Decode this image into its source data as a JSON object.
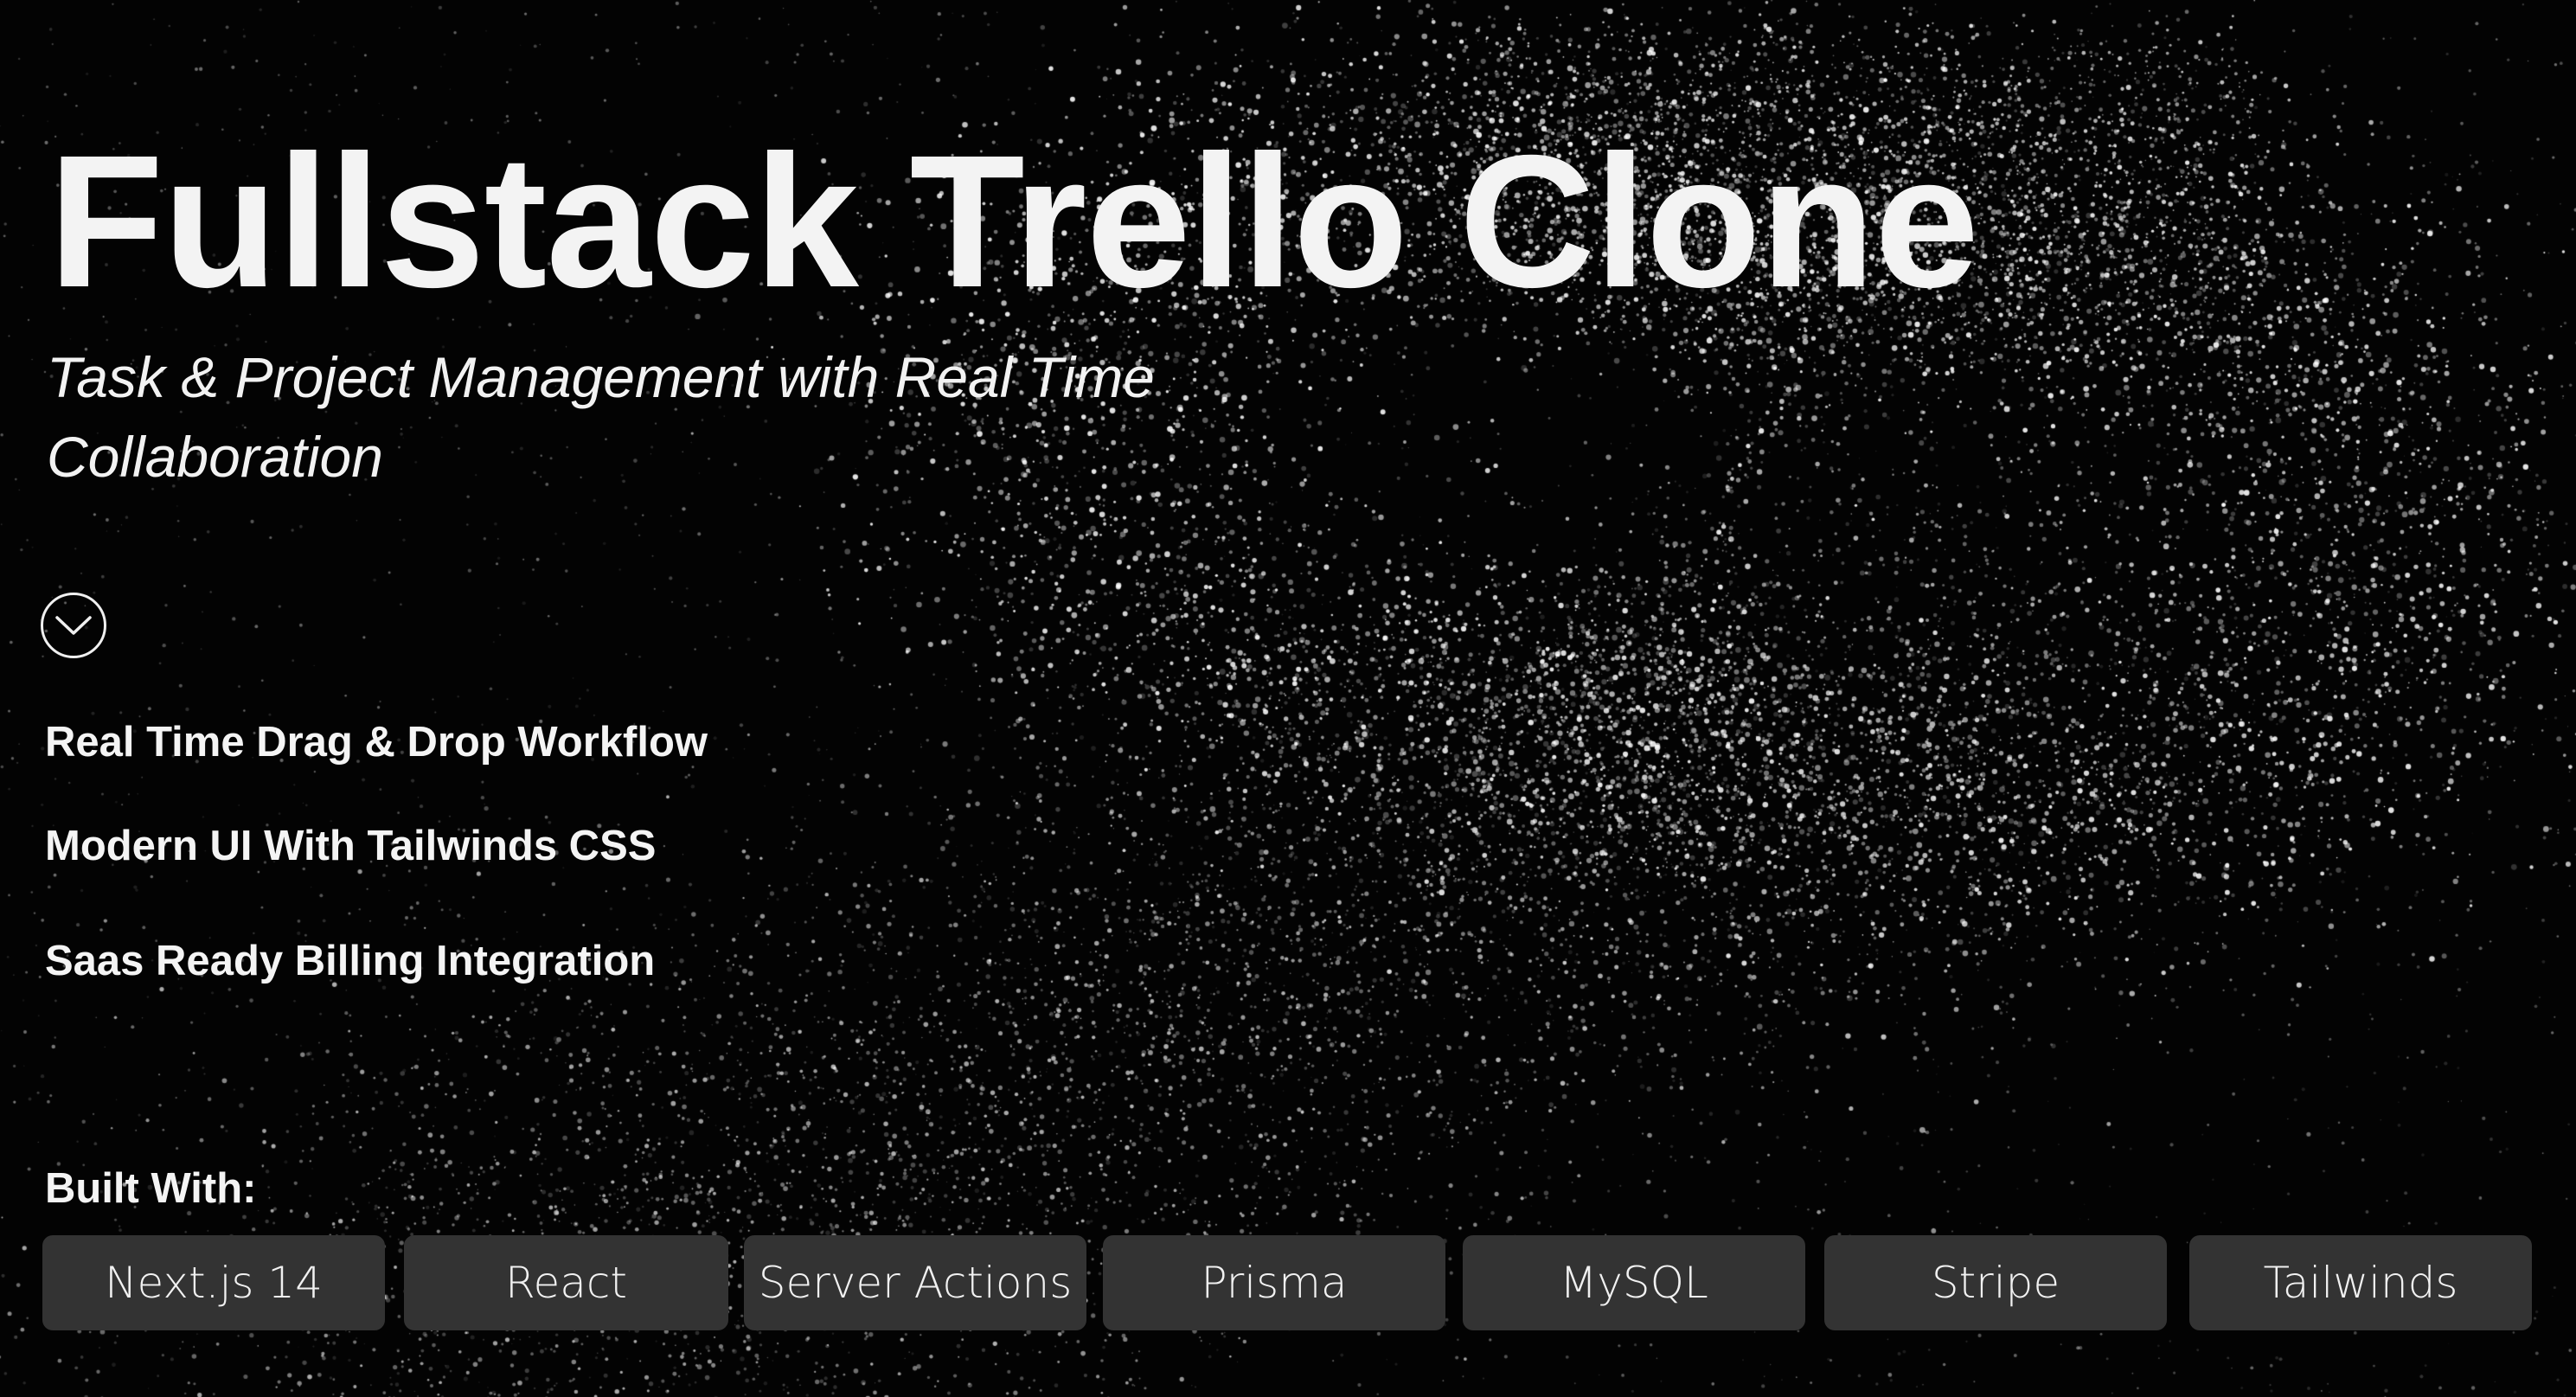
{
  "hero": {
    "title": "Fullstack Trello Clone",
    "subtitle": "Task & Project Management with Real Time Collaboration"
  },
  "scroll_button": {
    "icon": "chevron-down-icon"
  },
  "features": [
    "Real Time Drag & Drop Workflow",
    "Modern UI With Tailwinds CSS",
    "Saas Ready Billing Integration"
  ],
  "built_with": {
    "label": "Built With:",
    "technologies": [
      "Next.js 14",
      "React",
      "Server Actions",
      "Prisma",
      "MySQL",
      "Stripe",
      "Tailwinds"
    ]
  },
  "colors": {
    "background": "#030303",
    "text": "#f4f4f4",
    "chip": "#333333",
    "particles": "#ffffff"
  }
}
